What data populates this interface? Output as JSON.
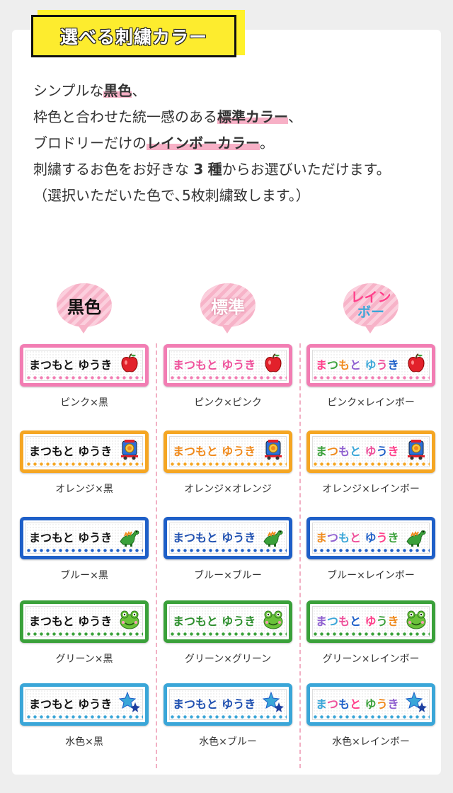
{
  "heading": "選べる刺繍カラー",
  "intro": {
    "line1": {
      "hl": "黒色",
      "rest": "、"
    },
    "line2": {
      "pre": "枠色と合わせた統一感のある",
      "hl": "標準カラー",
      "rest": "、"
    },
    "line3": {
      "pre": "ブロドリーだけの",
      "hl": "レインボーカラー",
      "rest": "。"
    },
    "line4": {
      "pre": "刺繍するお色をお好きな",
      "num": "3",
      "mid": "種",
      "rest": "からお選びいただけます。"
    },
    "line5": "（選択いただいた色で､5枚刺繍致します。）",
    "line1_pre": "シンプルな"
  },
  "tag_name": "まつもと ゆうき",
  "columns": [
    {
      "badge": "黒色",
      "captions": [
        "ピンク×黒",
        "オレンジ×黒",
        "ブルー×黒",
        "グリーン×黒",
        "水色×黒"
      ]
    },
    {
      "badge": "標準",
      "captions": [
        "ピンク×ピンク",
        "オレンジ×オレンジ",
        "ブルー×ブルー",
        "グリーン×グリーン",
        "水色×ブルー"
      ]
    },
    {
      "badge_line1": "レイン",
      "badge_line2": "ボー",
      "captions": [
        "ピンク×レインボー",
        "オレンジ×レインボー",
        "ブルー×レインボー",
        "グリーン×レインボー",
        "水色×レインボー"
      ]
    }
  ],
  "frame_colors": [
    "#f27db3",
    "#f5a623",
    "#1e5fc8",
    "#3aa13a",
    "#3aa6d8"
  ],
  "standard_text_colors": [
    "#ee4f9a",
    "#f08a1c",
    "#1e4fb0",
    "#2e8f2e",
    "#1e4fb0"
  ],
  "rainbow_text_colors": [
    "#ff3f8a",
    "#3aa13a",
    "#f08a1c",
    "#8f5fd0",
    "#3aa6d8",
    "#ee4f9a",
    "#1e5fc8"
  ],
  "icons": [
    "apple-icon",
    "train-icon",
    "dinosaur-icon",
    "frog-icon",
    "star-icon"
  ],
  "accent_yellow": "#fdec2e",
  "highlight_pink": "#f7b0c6"
}
